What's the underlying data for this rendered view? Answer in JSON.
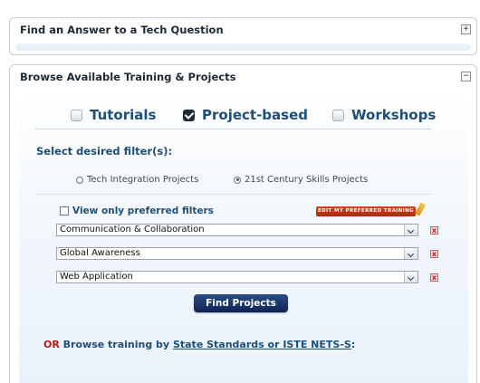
{
  "panel1": {
    "title": "Find an Answer to a Tech Question",
    "toggle": "+"
  },
  "panel2": {
    "title": "Browse Available Training & Projects",
    "toggle": "−"
  },
  "types": [
    {
      "label": "Tutorials",
      "checked": false
    },
    {
      "label": "Project-based",
      "checked": true
    },
    {
      "label": "Workshops",
      "checked": false
    }
  ],
  "filters": {
    "title": "Select desired filter(s):",
    "radio": [
      {
        "label": "Tech Integration Projects",
        "selected": false
      },
      {
        "label": "21st Century Skills Projects",
        "selected": true
      }
    ],
    "pref_label": "View only preferred filters",
    "edit_button": "EDIT MY PREFERRED TRAINING",
    "selects": [
      {
        "value": "Communication & Collaboration"
      },
      {
        "value": "Global Awareness"
      },
      {
        "value": "Web Application"
      }
    ],
    "remove_label": "x"
  },
  "find_button": "Find Projects",
  "browse": {
    "or": "OR",
    "text": "Browse training by",
    "link": "State Standards or ISTE NETS-S",
    "suffix": ":"
  }
}
